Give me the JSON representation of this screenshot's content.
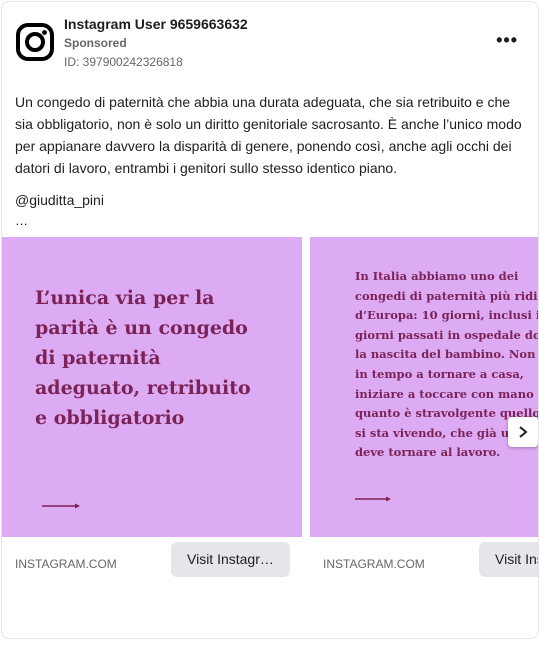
{
  "post": {
    "author": "Instagram User 9659663632",
    "sponsored": "Sponsored",
    "ad_id": "ID: 397900242326818",
    "more_label": "•••",
    "body": "Un congedo di paternità che abbia una durata adeguata, che sia retribuito e che sia obbligatorio, non è solo un diritto genitoriale sacrosanto. È anche l’unico modo per appianare davvero la disparità di genere, ponendo così, anche agli occhi dei datori di lavoro, entrambi i genitori sullo stesso identico piano.",
    "handle": "@giuditta_pini",
    "ellipsis": "…"
  },
  "carousel": {
    "cards": [
      {
        "text_lines": [
          "L’unica via per la",
          "parità è un congedo",
          "di paternità",
          "adeguato, retribuito",
          "e obbligatorio"
        ],
        "domain": "INSTAGRAM.COM",
        "cta": "Visit Instagram profile"
      },
      {
        "text_lines": [
          "In Italia abbiamo uno dei",
          "congedi di paternità più ridicoli",
          "d’Europa: 10 giorni, inclusi i",
          "giorni passati in ospedale dopo",
          "la nascita del bambino. Non si fa",
          "in tempo a tornare a casa,",
          "iniziare a toccare con mano",
          "quanto è stravolgente quello che",
          "si sta vivendo, che già uno",
          "deve tornare al lavoro."
        ],
        "domain": "INSTAGRAM.COM",
        "cta": "Visit Instagram profile"
      }
    ],
    "slide_color": "#ddaaf4",
    "text_color": "#7b2356"
  }
}
